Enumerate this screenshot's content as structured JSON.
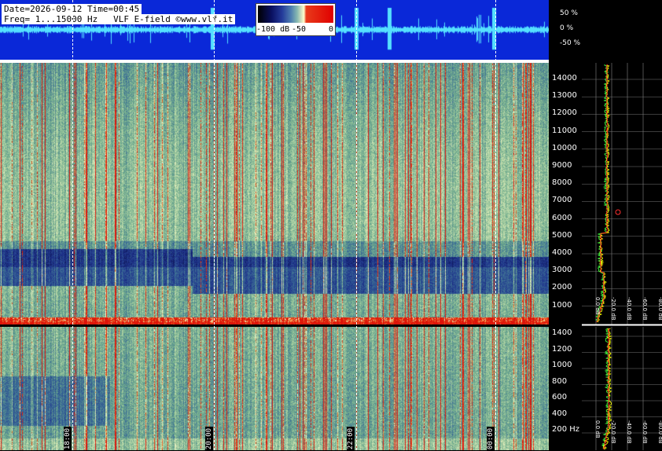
{
  "info": {
    "line1": "Date=2026-09-12 Time=00:45",
    "line2": "Freq= 1...15000 Hz   VLF E-field ©www.vlf.it"
  },
  "colorbar": {
    "labels": [
      "-100 dB",
      "-50",
      "0"
    ]
  },
  "waveform_scale": {
    "labels": [
      "50 %",
      "0 %",
      "-50 %"
    ]
  },
  "freq_axis_top": {
    "labels": [
      "14000",
      "13000",
      "12000",
      "11000",
      "10000",
      "9000",
      "8000",
      "7000",
      "6000",
      "5000",
      "4000",
      "3000",
      "2000",
      "1000"
    ]
  },
  "freq_axis_bottom": {
    "labels": [
      "1400",
      "1200",
      "1000",
      "800",
      "600",
      "400",
      "200 Hz"
    ]
  },
  "time_labels": [
    "18:00",
    "20:00",
    "22:00",
    "00:00"
  ],
  "db_labels_top": [
    "0.0 dB",
    "-20.0 dB",
    "-40.0 dB",
    "-60.0 dB",
    "-80.0 dB",
    "-100.0 dB"
  ],
  "db_labels_bottom": [
    "0.0 dB",
    "-20.0 dB",
    "-40.0 dB",
    "-60.0 dB",
    "-80.0 dB",
    "-100.0 dB"
  ],
  "colors": {
    "waveform_bg": "#0a28d8",
    "waveform_trace": "#55e0ff",
    "spectrum_yellow": "#ffff00",
    "spectrum_red": "#ff2020",
    "spectrum_green": "#40ff40"
  }
}
